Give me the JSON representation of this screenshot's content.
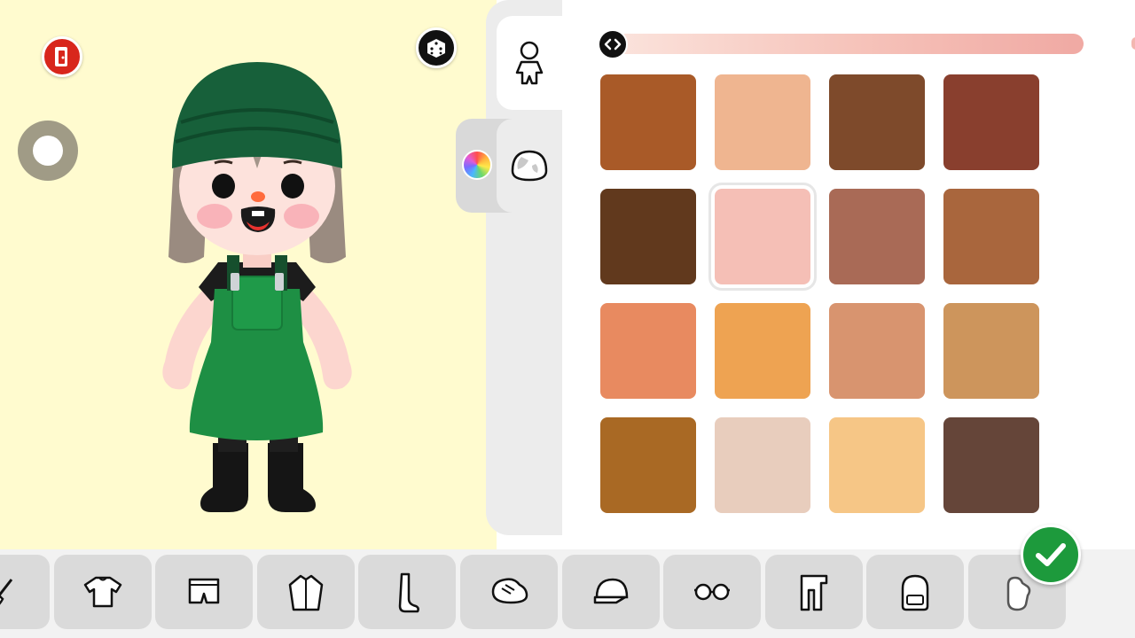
{
  "preview": {
    "exit_icon": "exit-door-icon",
    "random_icon": "dice-icon",
    "rotate_icon": "rotate-handle-icon"
  },
  "side_tabs": [
    {
      "name": "body",
      "icon": "body-figure-icon"
    },
    {
      "name": "color",
      "icon": "color-wheel-icon",
      "active": true
    },
    {
      "name": "head",
      "icon": "head-shape-icon"
    }
  ],
  "tone_slider": {
    "icon": "arrows-left-right-icon",
    "value": 0.0,
    "colors": [
      "#fbe3dc",
      "#f0a9a3"
    ]
  },
  "skin_swatches": [
    {
      "color": "#a95a28"
    },
    {
      "color": "#efb590"
    },
    {
      "color": "#7e4a2b"
    },
    {
      "color": "#893f2e"
    },
    {
      "color": "#61391d"
    },
    {
      "color": "#f5bfb6",
      "selected": true
    },
    {
      "color": "#a96a56"
    },
    {
      "color": "#a9663d"
    },
    {
      "color": "#e88a60"
    },
    {
      "color": "#eea352"
    },
    {
      "color": "#d8946f"
    },
    {
      "color": "#cd955c"
    },
    {
      "color": "#a96924"
    },
    {
      "color": "#e8cdbd"
    },
    {
      "color": "#f6c686"
    },
    {
      "color": "#654539"
    }
  ],
  "bottom_categories": [
    {
      "name": "makeup",
      "icon": "brush-icon"
    },
    {
      "name": "tops",
      "icon": "tshirt-icon"
    },
    {
      "name": "bottoms",
      "icon": "shorts-icon"
    },
    {
      "name": "outerwear",
      "icon": "jacket-icon"
    },
    {
      "name": "socks",
      "icon": "sock-icon"
    },
    {
      "name": "shoes",
      "icon": "shoe-icon"
    },
    {
      "name": "hats",
      "icon": "cap-icon"
    },
    {
      "name": "glasses",
      "icon": "glasses-icon"
    },
    {
      "name": "scarves",
      "icon": "scarf-icon"
    },
    {
      "name": "bags",
      "icon": "backpack-icon"
    },
    {
      "name": "accessories",
      "icon": "glove-icon"
    }
  ],
  "confirm": {
    "icon": "checkmark-icon",
    "color": "#1d9a3c"
  },
  "colors": {
    "preview_bg": "#fffbcf",
    "panel_bg": "#ffffff",
    "category_bg": "#dadada",
    "exit_red": "#d8261c"
  }
}
